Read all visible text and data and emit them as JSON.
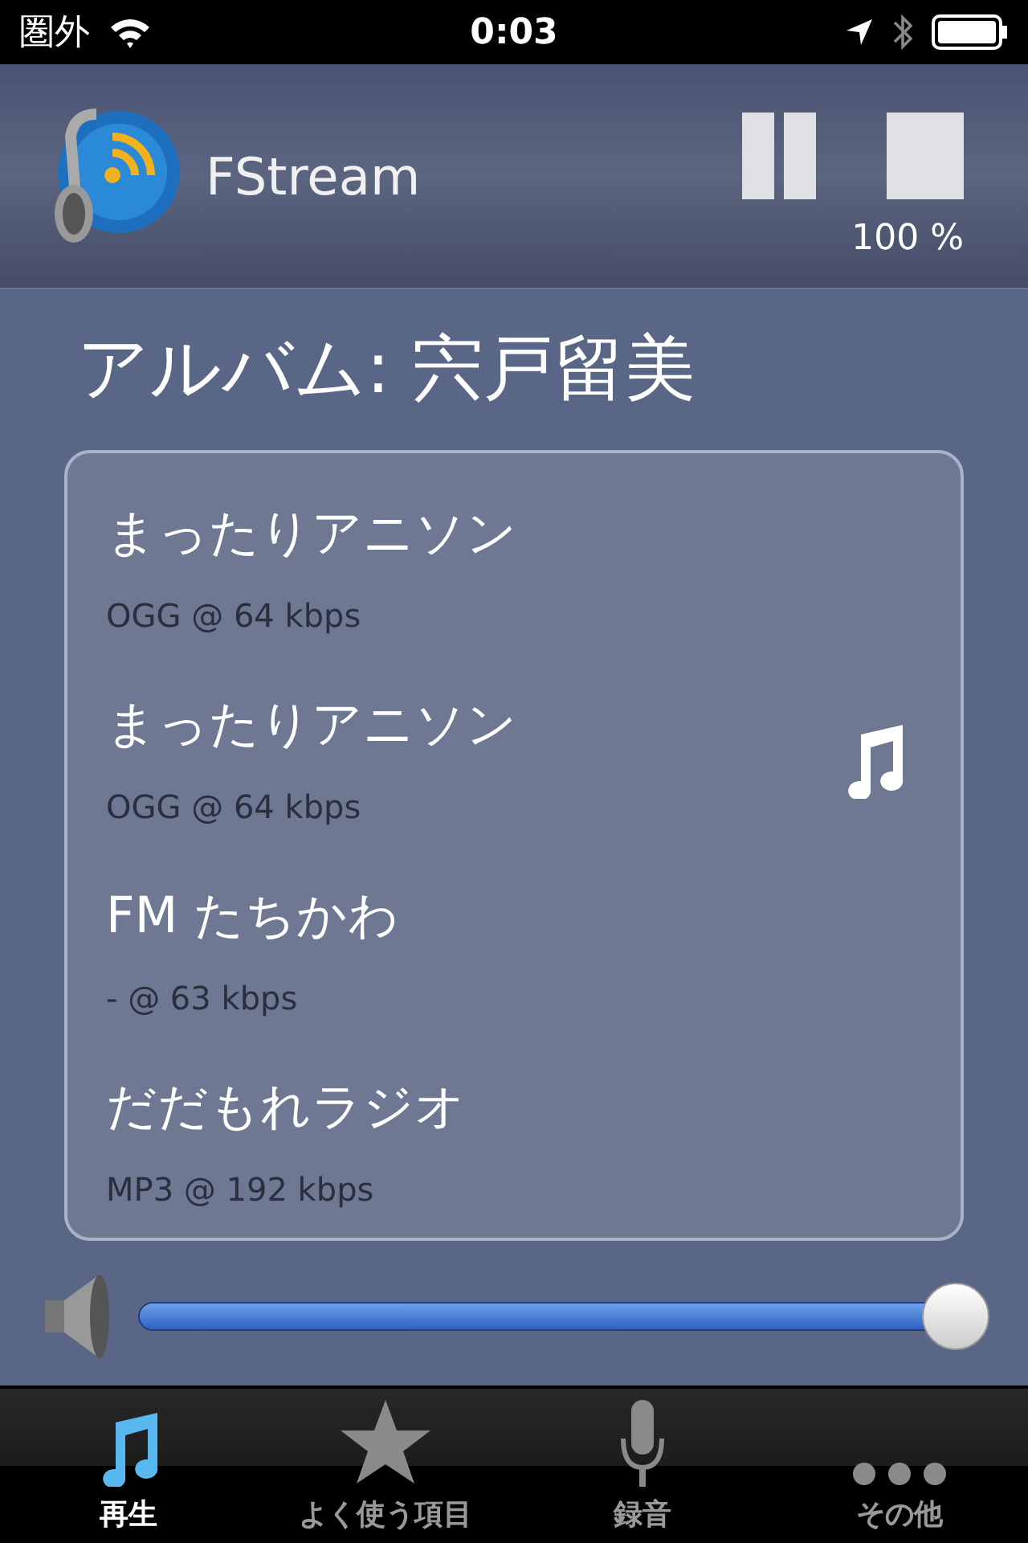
{
  "status_bar": {
    "carrier": "圏外",
    "time": "0:03"
  },
  "header": {
    "app_name": "FStream",
    "volume_percent": "100 %"
  },
  "now_playing": {
    "title": "アルバム: 宍戸留美"
  },
  "stations": [
    {
      "name": "まったりアニソン",
      "format": "OGG @ 64 kbps",
      "playing": false
    },
    {
      "name": "まったりアニソン",
      "format": "OGG @ 64 kbps",
      "playing": true
    },
    {
      "name": "FM たちかわ",
      "format": "- @ 63 kbps",
      "playing": false
    },
    {
      "name": "だだもれラジオ",
      "format": "MP3 @ 192 kbps",
      "playing": false
    }
  ],
  "volume": {
    "level": 1
  },
  "tabs": [
    {
      "label": "再生",
      "kind": "note",
      "selected": true
    },
    {
      "label": "よく使う項目",
      "kind": "star",
      "selected": false
    },
    {
      "label": "録音",
      "kind": "mic",
      "selected": false
    },
    {
      "label": "その他",
      "kind": "more",
      "selected": false
    }
  ]
}
